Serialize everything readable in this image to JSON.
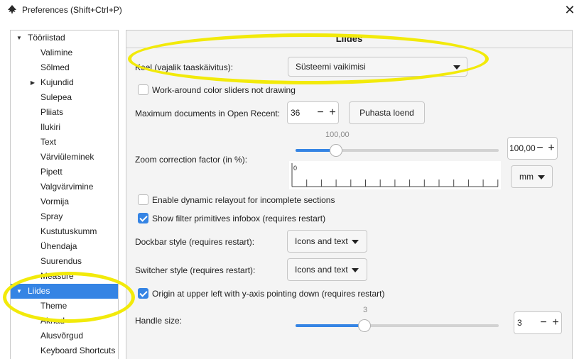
{
  "window": {
    "title": "Preferences (Shift+Ctrl+P)",
    "app_icon": "inkscape-icon",
    "close_icon": "close-icon"
  },
  "sidebar": {
    "items": [
      {
        "label": "Tööriistad",
        "level": 0,
        "arrow": "expanded",
        "selected": false
      },
      {
        "label": "Valimine",
        "level": 1,
        "arrow": "",
        "selected": false
      },
      {
        "label": "Sõlmed",
        "level": 1,
        "arrow": "",
        "selected": false
      },
      {
        "label": "Kujundid",
        "level": 1,
        "arrow": "collapsed",
        "selected": false
      },
      {
        "label": "Sulepea",
        "level": 1,
        "arrow": "",
        "selected": false
      },
      {
        "label": "Pliiats",
        "level": 1,
        "arrow": "",
        "selected": false
      },
      {
        "label": "Ilukiri",
        "level": 1,
        "arrow": "",
        "selected": false
      },
      {
        "label": "Text",
        "level": 1,
        "arrow": "",
        "selected": false
      },
      {
        "label": "Värviüleminek",
        "level": 1,
        "arrow": "",
        "selected": false
      },
      {
        "label": "Pipett",
        "level": 1,
        "arrow": "",
        "selected": false
      },
      {
        "label": "Valgvärvimine",
        "level": 1,
        "arrow": "",
        "selected": false
      },
      {
        "label": "Vormija",
        "level": 1,
        "arrow": "",
        "selected": false
      },
      {
        "label": "Spray",
        "level": 1,
        "arrow": "",
        "selected": false
      },
      {
        "label": "Kustutuskumm",
        "level": 1,
        "arrow": "",
        "selected": false
      },
      {
        "label": "Ühendaja",
        "level": 1,
        "arrow": "",
        "selected": false
      },
      {
        "label": "Suurendus",
        "level": 1,
        "arrow": "",
        "selected": false
      },
      {
        "label": "Measure",
        "level": 1,
        "arrow": "",
        "selected": false
      },
      {
        "label": "Liides",
        "level": 0,
        "arrow": "expanded",
        "selected": true
      },
      {
        "label": "Theme",
        "level": 1,
        "arrow": "",
        "selected": false
      },
      {
        "label": "Aknad",
        "level": 1,
        "arrow": "",
        "selected": false
      },
      {
        "label": "Alusvõrgud",
        "level": 1,
        "arrow": "",
        "selected": false
      },
      {
        "label": "Keyboard Shortcuts",
        "level": 1,
        "arrow": "",
        "selected": false
      }
    ]
  },
  "main": {
    "section_title": "Liides",
    "language": {
      "label": "Keel (vajalik taaskäivitus):",
      "value": "Süsteemi vaikimisi"
    },
    "workaround": {
      "label": "Work-around color sliders not drawing",
      "checked": false
    },
    "recent": {
      "label": "Maximum documents in Open Recent:",
      "value": "36",
      "minus": "−",
      "plus": "+",
      "clear_button": "Puhasta loend"
    },
    "zoom": {
      "label": "Zoom correction factor (in %):",
      "slider_value_text": "100,00",
      "slider_fraction": 0.2,
      "spin_value": "100,00",
      "minus": "−",
      "plus": "+",
      "ruler_zero": "0",
      "unit": "mm"
    },
    "dynamic_relayout": {
      "label": "Enable dynamic relayout for incomplete sections",
      "checked": false
    },
    "filter_infobox": {
      "label": "Show filter primitives infobox (requires restart)",
      "checked": true
    },
    "dockbar": {
      "label": "Dockbar style (requires restart):",
      "value": "Icons and text"
    },
    "switcher": {
      "label": "Switcher style (requires restart):",
      "value": "Icons and text"
    },
    "origin": {
      "label": "Origin at upper left with y-axis pointing down (requires restart)",
      "checked": true
    },
    "handle": {
      "label": "Handle size:",
      "slider_value_text": "3",
      "slider_fraction": 0.34,
      "spin_value": "3",
      "minus": "−",
      "plus": "+"
    }
  },
  "colors": {
    "accent": "#3584e4",
    "highlight_marker": "#f2ea0a"
  }
}
